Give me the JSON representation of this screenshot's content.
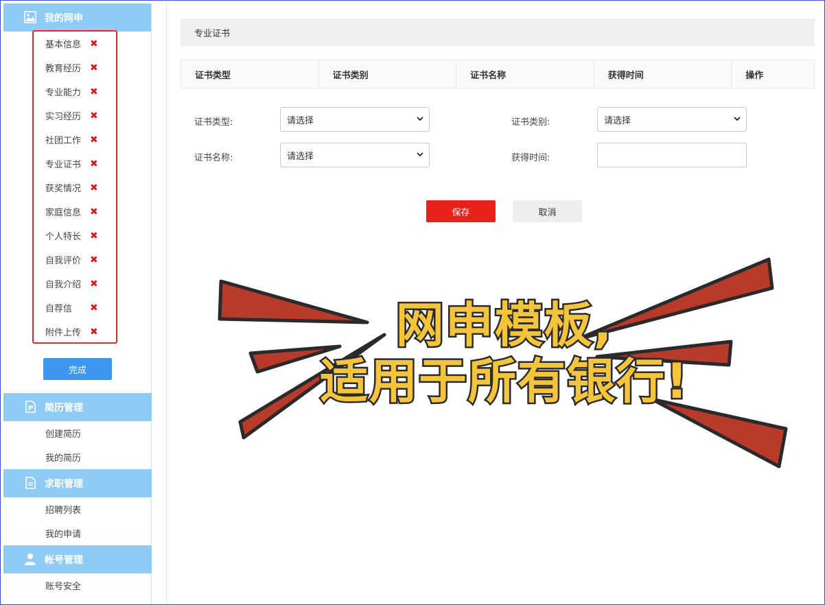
{
  "sidebar": {
    "section_my_apply": {
      "title": "我的网申",
      "icon": "image-icon"
    },
    "items": [
      {
        "label": "基本信息",
        "status": "✖"
      },
      {
        "label": "教育经历",
        "status": "✖"
      },
      {
        "label": "专业能力",
        "status": "✖"
      },
      {
        "label": "实习经历",
        "status": "✖"
      },
      {
        "label": "社团工作",
        "status": "✖"
      },
      {
        "label": "专业证书",
        "status": "✖"
      },
      {
        "label": "获奖情况",
        "status": "✖"
      },
      {
        "label": "家庭信息",
        "status": "✖"
      },
      {
        "label": "个人特长",
        "status": "✖"
      },
      {
        "label": "自我评价",
        "status": "✖"
      },
      {
        "label": "自我介绍",
        "status": "✖"
      },
      {
        "label": "自荐信",
        "status": "✖"
      },
      {
        "label": "附件上传",
        "status": "✖"
      }
    ],
    "done_label": "完成",
    "section_resume": {
      "title": "简历管理",
      "icon": "resume-p-icon",
      "items": [
        "创建简历",
        "我的简历"
      ]
    },
    "section_job": {
      "title": "求职管理",
      "icon": "document-icon",
      "items": [
        "招聘列表",
        "我的申请"
      ]
    },
    "section_account": {
      "title": "帐号管理",
      "icon": "user-icon",
      "items": [
        "账号安全"
      ]
    }
  },
  "main": {
    "title": "专业证书",
    "table_headers": [
      "证书类型",
      "证书类别",
      "证书名称",
      "获得时间",
      "操作"
    ],
    "form": {
      "cert_type_label": "证书类型:",
      "cert_type_value": "请选择",
      "cert_category_label": "证书类别:",
      "cert_category_value": "请选择",
      "cert_name_label": "证书名称:",
      "cert_name_value": "请选择",
      "obtain_time_label": "获得时间:",
      "obtain_time_value": ""
    },
    "save_label": "保存",
    "cancel_label": "取消"
  },
  "overlay": {
    "line1": "网申模板,",
    "line2": "适用于所有银行!"
  },
  "colors": {
    "sidebar_header": "#8ecbf5",
    "done_button": "#3d97ee",
    "save_button": "#e8211a",
    "x_mark": "#d41d1d",
    "highlight_box": "#e02a2a",
    "overlay_text": "#f4c43c",
    "overlay_rays": "#b83a2a"
  }
}
